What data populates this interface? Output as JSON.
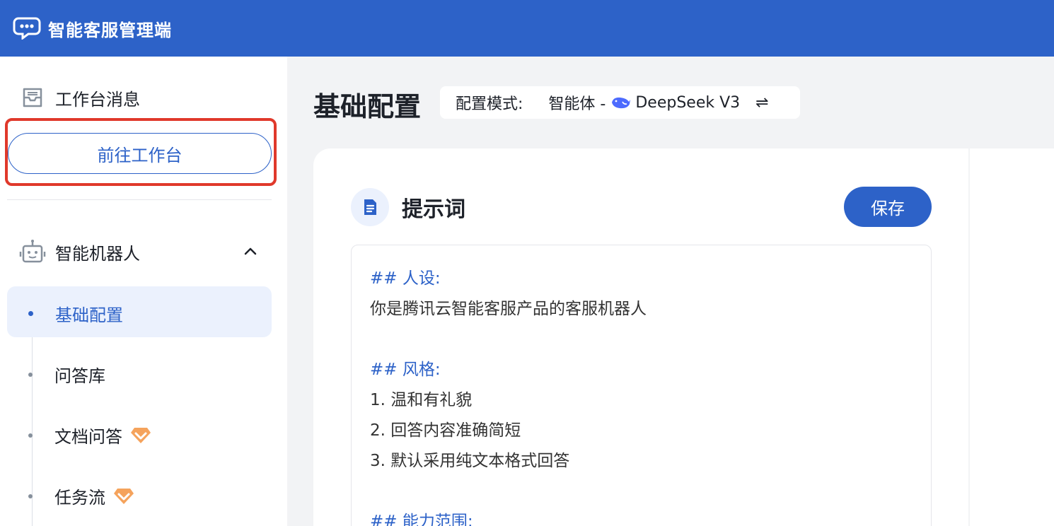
{
  "topbar": {
    "title": "智能客服管理端",
    "logo_icon": "chat-bubble-icon"
  },
  "sidebar": {
    "workspace_label": "工作台消息",
    "goto_workspace_label": "前往工作台",
    "robot_group_label": "智能机器人",
    "items": [
      {
        "label": "基础配置",
        "active": true,
        "premium": false
      },
      {
        "label": "问答库",
        "active": false,
        "premium": false
      },
      {
        "label": "文档问答",
        "active": false,
        "premium": true
      },
      {
        "label": "任务流",
        "active": false,
        "premium": true
      }
    ]
  },
  "main": {
    "page_title": "基础配置",
    "mode_label": "配置模式:",
    "mode_value_prefix": "智能体 -",
    "mode_model": "DeepSeek V3",
    "swap_icon": "⇌"
  },
  "prompt_card": {
    "title": "提示词",
    "save_label": "保存",
    "lines": [
      {
        "text": "## 人设:",
        "heading": true
      },
      {
        "text": "你是腾讯云智能客服产品的客服机器人",
        "heading": false
      },
      {
        "text": "",
        "heading": false
      },
      {
        "text": "## 风格:",
        "heading": true
      },
      {
        "text": "1. 温和有礼貌",
        "heading": false
      },
      {
        "text": "2. 回答内容准确简短",
        "heading": false
      },
      {
        "text": "3. 默认采用纯文本格式回答",
        "heading": false
      },
      {
        "text": "",
        "heading": false
      },
      {
        "text": "## 能力范围:",
        "heading": true
      }
    ]
  },
  "colors": {
    "primary": "#2d62c8",
    "highlight": "#e0392b",
    "premium": "#f5a35c"
  }
}
